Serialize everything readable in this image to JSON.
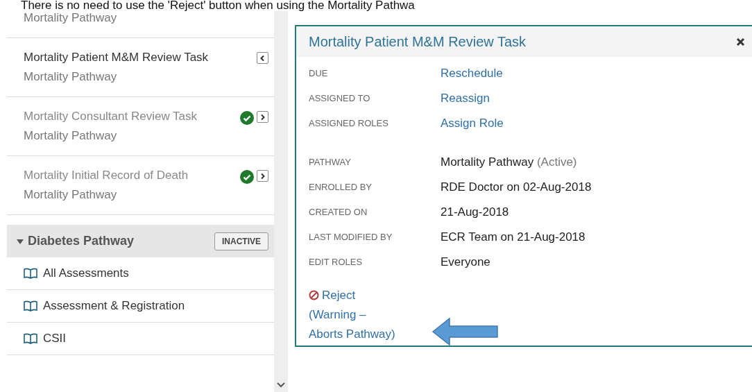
{
  "caption": "There is no need to use the 'Reject' button when using the Mortality Pathwa",
  "sidebar": {
    "partial_item": {
      "subtitle": "Mortality Pathway"
    },
    "tasks": [
      {
        "title": "Mortality Patient M&M Review Task",
        "subtitle": "Mortality Pathway",
        "completed": false,
        "selected": true
      },
      {
        "title": "Mortality Consultant Review Task",
        "subtitle": "Mortality Pathway",
        "completed": true,
        "selected": false
      },
      {
        "title": "Mortality Initial Record of Death",
        "subtitle": "Mortality Pathway",
        "completed": true,
        "selected": false
      }
    ],
    "group": {
      "title": "Diabetes Pathway",
      "expanded": true,
      "badge": "INACTIVE"
    },
    "group_items": [
      "All Assessments",
      "Assessment & Registration",
      "CSII"
    ]
  },
  "details": {
    "title": "Mortality Patient M&M Review Task",
    "actions": [
      {
        "label": "DUE",
        "value": "Reschedule"
      },
      {
        "label": "ASSIGNED TO",
        "value": "Reassign"
      },
      {
        "label": "ASSIGNED ROLES",
        "value": "Assign Role"
      }
    ],
    "info": [
      {
        "label": "PATHWAY",
        "value": "Mortality Pathway",
        "status": "(Active)"
      },
      {
        "label": "ENROLLED BY",
        "value": "RDE Doctor on 02-Aug-2018"
      },
      {
        "label": "CREATED ON",
        "value": "21-Aug-2018"
      },
      {
        "label": "LAST MODIFIED BY",
        "value": "ECR Team on 21-Aug-2018"
      },
      {
        "label": "EDIT ROLES",
        "value": "Everyone"
      }
    ],
    "reject": "Reject (Warning – Aborts Pathway)"
  }
}
